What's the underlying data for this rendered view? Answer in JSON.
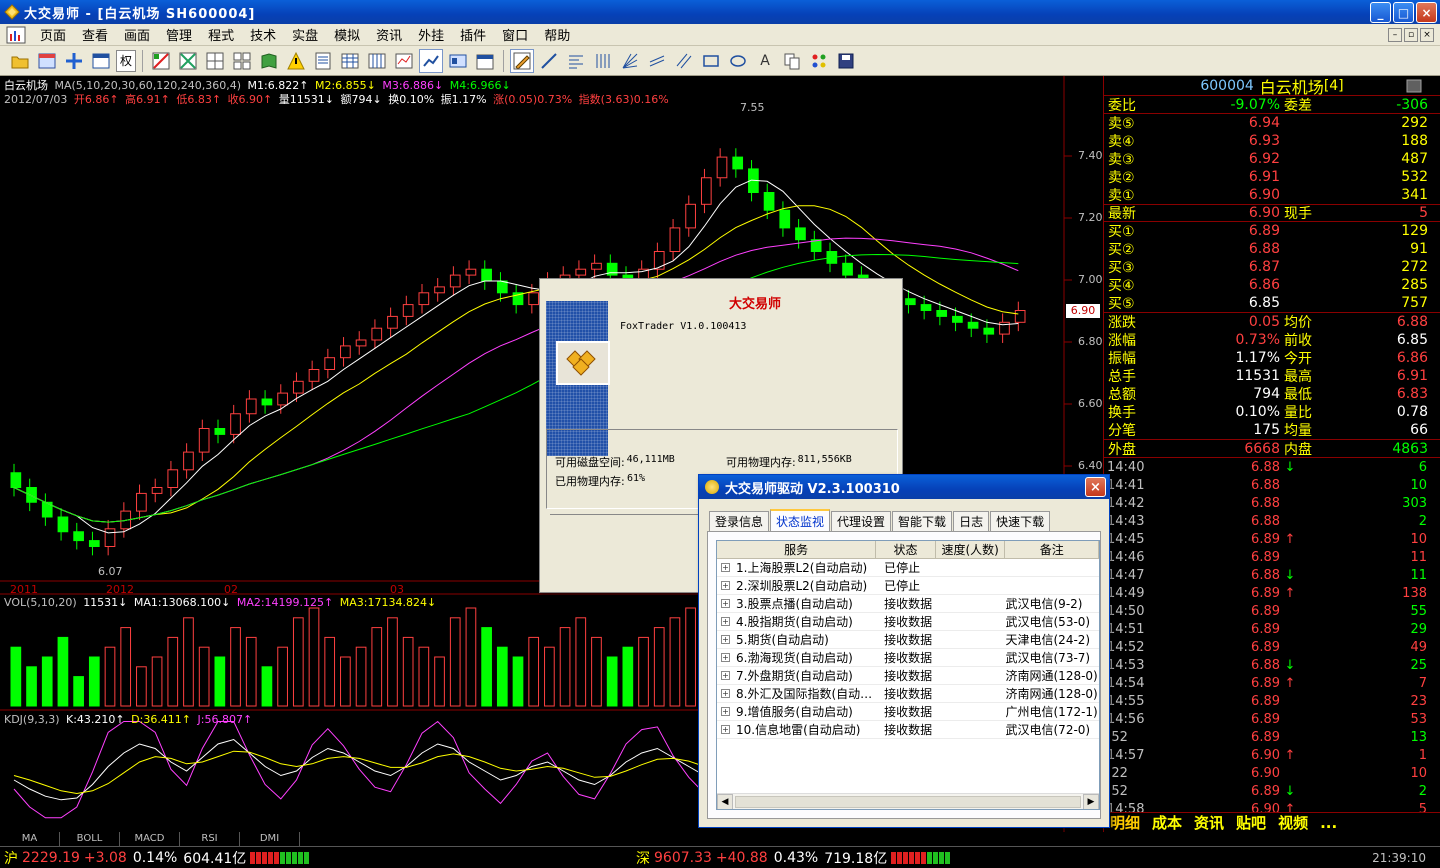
{
  "window": {
    "title": "大交易师 - [白云机场 SH600004]",
    "min": "_",
    "max": "□",
    "close": "×"
  },
  "menu": [
    "页面",
    "查看",
    "画面",
    "管理",
    "程式",
    "技术",
    "实盘",
    "模拟",
    "资讯",
    "外挂",
    "插件",
    "窗口",
    "帮助"
  ],
  "toolbar": {
    "rights_label": "权",
    "text_tool": "A"
  },
  "chart": {
    "stock_label": "白云机场",
    "ma_header": "MA(5,10,20,30,60,120,240,360,4)",
    "m1": "M1:6.822↑",
    "m2": "M2:6.855↓",
    "m3": "M3:6.886↓",
    "m4": "M4:6.966↓",
    "date": "2012/07/03",
    "open": "开6.86↑",
    "high": "高6.91↑",
    "low": "低6.83↑",
    "close": "收6.90↑",
    "vol": "量11531↓",
    "amount": "额794↓",
    "turnover": "换0.10%",
    "amplitude": "振1.17%",
    "change": "涨(0.05)0.73%",
    "index": "指数(3.63)0.16%",
    "price_ticks": [
      "7.40",
      "7.20",
      "7.00",
      "6.80",
      "6.60",
      "6.40"
    ],
    "current_price": "6.90",
    "hi_mark": "7.55",
    "lo_mark": "6.07",
    "time_labels": [
      "2011",
      "2012",
      "02",
      "03"
    ],
    "vol_header": "VOL(5,10,20)",
    "vol_value": "11531↓",
    "vol_ma1": "MA1:13068.100↓",
    "vol_ma2": "MA2:14199.125↑",
    "vol_ma3": "MA3:17134.824↓",
    "kdj_header": "KDJ(9,3,3)",
    "kdj_k": "K:43.210↑",
    "kdj_d": "D:36.411↑",
    "kdj_j": "J:56.807↑",
    "candles": {
      "opens": [
        6.35,
        6.3,
        6.25,
        6.2,
        6.15,
        6.12,
        6.1,
        6.16,
        6.22,
        6.28,
        6.3,
        6.36,
        6.42,
        6.5,
        6.48,
        6.55,
        6.6,
        6.58,
        6.62,
        6.66,
        6.7,
        6.74,
        6.78,
        6.8,
        6.84,
        6.88,
        6.92,
        6.96,
        6.98,
        7.02,
        7.04,
        7.0,
        6.96,
        6.92,
        6.96,
        7.0,
        7.02,
        7.04,
        7.06,
        7.02,
        7.0,
        7.04,
        7.1,
        7.18,
        7.26,
        7.35,
        7.42,
        7.38,
        7.3,
        7.24,
        7.18,
        7.14,
        7.1,
        7.06,
        7.02,
        6.98,
        6.96,
        6.94,
        6.92,
        6.9,
        6.88,
        6.86,
        6.84,
        6.82,
        6.86
      ],
      "closes": [
        6.3,
        6.25,
        6.2,
        6.15,
        6.12,
        6.1,
        6.16,
        6.22,
        6.28,
        6.3,
        6.36,
        6.42,
        6.5,
        6.48,
        6.55,
        6.6,
        6.58,
        6.62,
        6.66,
        6.7,
        6.74,
        6.78,
        6.8,
        6.84,
        6.88,
        6.92,
        6.96,
        6.98,
        7.02,
        7.04,
        7.0,
        6.96,
        6.92,
        6.96,
        7.0,
        7.02,
        7.04,
        7.06,
        7.02,
        7.0,
        7.04,
        7.1,
        7.18,
        7.26,
        7.35,
        7.42,
        7.38,
        7.3,
        7.24,
        7.18,
        7.14,
        7.1,
        7.06,
        7.02,
        6.98,
        6.96,
        6.94,
        6.92,
        6.9,
        6.88,
        6.86,
        6.84,
        6.82,
        6.86,
        6.9
      ]
    },
    "volumes": [
      0.6,
      0.4,
      0.5,
      0.7,
      0.3,
      0.5,
      0.6,
      0.8,
      0.4,
      0.5,
      0.7,
      0.9,
      0.6,
      0.5,
      0.8,
      0.7,
      0.4,
      0.6,
      0.9,
      1.0,
      0.7,
      0.5,
      0.6,
      0.8,
      0.9,
      0.7,
      0.6,
      0.5,
      0.9,
      1.0,
      0.8,
      0.6,
      0.5,
      0.7,
      0.6,
      0.8,
      0.9,
      0.7,
      0.5,
      0.6,
      0.7,
      0.8,
      0.9,
      1.0,
      0.95,
      0.9,
      0.7,
      0.6,
      0.5,
      0.6,
      0.7,
      0.5,
      0.6,
      0.7,
      0.6,
      0.5,
      0.4,
      0.5,
      0.6,
      0.7,
      0.5,
      0.4,
      0.5,
      0.6,
      0.5
    ],
    "kdj_k_vals": [
      40,
      30,
      22,
      18,
      20,
      35,
      55,
      70,
      80,
      75,
      60,
      50,
      65,
      80,
      85,
      70,
      55,
      45,
      50,
      65,
      75,
      70,
      60,
      50,
      45,
      55,
      70,
      80,
      75,
      60,
      50,
      40,
      45,
      55,
      60,
      50,
      40,
      35,
      45,
      60,
      70,
      75,
      65,
      55,
      45,
      40,
      50,
      60,
      55,
      45,
      38,
      32,
      40,
      50,
      55,
      48,
      40,
      36,
      42,
      50,
      46,
      40,
      38,
      42,
      43
    ],
    "kdj_d_vals": [
      45,
      40,
      34,
      28,
      25,
      28,
      36,
      48,
      60,
      66,
      64,
      58,
      60,
      66,
      72,
      71,
      65,
      58,
      55,
      58,
      64,
      66,
      64,
      59,
      54,
      54,
      59,
      66,
      69,
      66,
      60,
      53,
      50,
      52,
      55,
      53,
      48,
      43,
      44,
      50,
      57,
      63,
      64,
      61,
      55,
      50,
      50,
      53,
      54,
      51,
      46,
      41,
      41,
      44,
      48,
      48,
      45,
      42,
      42,
      45,
      45,
      43,
      41,
      41,
      36
    ]
  },
  "about": {
    "title": "大交易师",
    "version": "FoxTrader V1.0.100413",
    "disk_label": "可用磁盘空间:",
    "disk_value": "46,111MB",
    "phys_label": "可用物理内存:",
    "phys_value": "811,556KB",
    "used_label": "已用物理内存:",
    "used_value": "61%"
  },
  "driver": {
    "title": "大交易师驱动 V2.3.100310",
    "close": "×",
    "tabs": [
      "登录信息",
      "状态监视",
      "代理设置",
      "智能下载",
      "日志",
      "快速下载"
    ],
    "active_tab": 1,
    "columns": [
      "服务",
      "状态",
      "速度(人数)",
      "备注"
    ],
    "rows": [
      {
        "service": "1.上海股票L2(自动启动)",
        "status": "已停止",
        "speed": "",
        "note": ""
      },
      {
        "service": "2.深圳股票L2(自动启动)",
        "status": "已停止",
        "speed": "",
        "note": ""
      },
      {
        "service": "3.股票点播(自动启动)",
        "status": "接收数据",
        "speed": "",
        "note": "武汉电信(9-2)"
      },
      {
        "service": "4.股指期货(自动启动)",
        "status": "接收数据",
        "speed": "",
        "note": "武汉电信(53-0)"
      },
      {
        "service": "5.期货(自动启动)",
        "status": "接收数据",
        "speed": "",
        "note": "天津电信(24-2)"
      },
      {
        "service": "6.渤海现货(自动启动)",
        "status": "接收数据",
        "speed": "",
        "note": "武汉电信(73-7)"
      },
      {
        "service": "7.外盘期货(自动启动)",
        "status": "接收数据",
        "speed": "",
        "note": "济南网通(128-0)"
      },
      {
        "service": "8.外汇及国际指数(自动…",
        "status": "接收数据",
        "speed": "",
        "note": "济南网通(128-0)"
      },
      {
        "service": "9.增值服务(自动启动)",
        "status": "接收数据",
        "speed": "",
        "note": "广州电信(172-1)"
      },
      {
        "service": "10.信息地雷(自动启动)",
        "status": "接收数据",
        "speed": "",
        "note": "武汉电信(72-0)"
      }
    ]
  },
  "quote": {
    "code": "600004",
    "name": "白云机场",
    "mark": "[4]",
    "weibi_label": "委比",
    "weibi": "-9.07%",
    "weicha_label": "委差",
    "weicha": "-306",
    "asks": [
      {
        "label": "卖⑤",
        "price": "6.94",
        "vol": "292"
      },
      {
        "label": "卖④",
        "price": "6.93",
        "vol": "188"
      },
      {
        "label": "卖③",
        "price": "6.92",
        "vol": "487"
      },
      {
        "label": "卖②",
        "price": "6.91",
        "vol": "532"
      },
      {
        "label": "卖①",
        "price": "6.90",
        "vol": "341"
      }
    ],
    "last_label": "最新",
    "last": "6.90",
    "xianshou_label": "现手",
    "xianshou": "5",
    "bids": [
      {
        "label": "买①",
        "price": "6.89",
        "vol": "129"
      },
      {
        "label": "买②",
        "price": "6.88",
        "vol": "91"
      },
      {
        "label": "买③",
        "price": "6.87",
        "vol": "272"
      },
      {
        "label": "买④",
        "price": "6.86",
        "vol": "285"
      },
      {
        "label": "买⑤",
        "price": "6.85",
        "vol": "757"
      }
    ],
    "stats": [
      {
        "l1": "涨跌",
        "v1": "0.05",
        "c1": "red",
        "l2": "均价",
        "v2": "6.88",
        "c2": "red"
      },
      {
        "l1": "涨幅",
        "v1": "0.73%",
        "c1": "red",
        "l2": "前收",
        "v2": "6.85",
        "c2": "white"
      },
      {
        "l1": "振幅",
        "v1": "1.17%",
        "c1": "white",
        "l2": "今开",
        "v2": "6.86",
        "c2": "red"
      },
      {
        "l1": "总手",
        "v1": "11531",
        "c1": "white",
        "l2": "最高",
        "v2": "6.91",
        "c2": "red"
      },
      {
        "l1": "总额",
        "v1": "794",
        "c1": "white",
        "l2": "最低",
        "v2": "6.83",
        "c2": "red"
      },
      {
        "l1": "换手",
        "v1": "0.10%",
        "c1": "white",
        "l2": "量比",
        "v2": "0.78",
        "c2": "white"
      },
      {
        "l1": "分笔",
        "v1": "175",
        "c1": "white",
        "l2": "均量",
        "v2": "66",
        "c2": "white"
      }
    ],
    "outer_label": "外盘",
    "outer": "6668",
    "inner_label": "内盘",
    "inner": "4863",
    "ticks": [
      {
        "t": "14:40",
        "p": "6.88",
        "a": "↓",
        "ac": "green",
        "v": "6",
        "vc": "green"
      },
      {
        "t": "14:41",
        "p": "6.88",
        "a": "",
        "ac": "",
        "v": "10",
        "vc": "green"
      },
      {
        "t": "14:42",
        "p": "6.88",
        "a": "",
        "ac": "",
        "v": "303",
        "vc": "green"
      },
      {
        "t": "14:43",
        "p": "6.88",
        "a": "",
        "ac": "",
        "v": "2",
        "vc": "green"
      },
      {
        "t": "14:45",
        "p": "6.89",
        "a": "↑",
        "ac": "red",
        "v": "10",
        "vc": "red"
      },
      {
        "t": "14:46",
        "p": "6.89",
        "a": "",
        "ac": "",
        "v": "11",
        "vc": "red"
      },
      {
        "t": "14:47",
        "p": "6.88",
        "a": "↓",
        "ac": "green",
        "v": "11",
        "vc": "green"
      },
      {
        "t": "14:49",
        "p": "6.89",
        "a": "↑",
        "ac": "red",
        "v": "138",
        "vc": "red"
      },
      {
        "t": "14:50",
        "p": "6.89",
        "a": "",
        "ac": "",
        "v": "55",
        "vc": "green"
      },
      {
        "t": "14:51",
        "p": "6.89",
        "a": "",
        "ac": "",
        "v": "29",
        "vc": "green"
      },
      {
        "t": "14:52",
        "p": "6.89",
        "a": "",
        "ac": "",
        "v": "49",
        "vc": "red"
      },
      {
        "t": "14:53",
        "p": "6.88",
        "a": "↓",
        "ac": "green",
        "v": "25",
        "vc": "green"
      },
      {
        "t": "14:54",
        "p": "6.89",
        "a": "↑",
        "ac": "red",
        "v": "7",
        "vc": "red"
      },
      {
        "t": "14:55",
        "p": "6.89",
        "a": "",
        "ac": "",
        "v": "23",
        "vc": "red"
      },
      {
        "t": "14:56",
        "p": "6.89",
        "a": "",
        "ac": "",
        "v": "53",
        "vc": "red"
      },
      {
        "t": ":52",
        "p": "6.89",
        "a": "",
        "ac": "",
        "v": "13",
        "vc": "green"
      },
      {
        "t": "14:57",
        "p": "6.90",
        "a": "↑",
        "ac": "red",
        "v": "1",
        "vc": "red"
      },
      {
        "t": ":22",
        "p": "6.90",
        "a": "",
        "ac": "",
        "v": "10",
        "vc": "red"
      },
      {
        "t": ":52",
        "p": "6.89",
        "a": "↓",
        "ac": "green",
        "v": "2",
        "vc": "green"
      },
      {
        "t": "14:58",
        "p": "6.90",
        "a": "↑",
        "ac": "red",
        "v": "5",
        "vc": "red"
      }
    ],
    "tabs": [
      "明细",
      "成本",
      "资讯",
      "贴吧",
      "视频",
      "..."
    ]
  },
  "indicator_tabs": [
    "MA",
    "BOLL",
    "MACD",
    "RSI",
    "DMI"
  ],
  "status": {
    "sh_label": "沪",
    "sh_index": "2229.19",
    "sh_change": "+3.08",
    "sh_pct": "0.14%",
    "sh_amount": "604.41亿",
    "sz_label": "深",
    "sz_index": "9607.33",
    "sz_change": "+40.88",
    "sz_pct": "0.43%",
    "sz_amount": "719.18亿",
    "clock": "21:39:10"
  },
  "colors": {
    "up": "#ff4040",
    "down": "#00ff00",
    "accent_yellow": "#ffff00",
    "grid_red": "#8a0000"
  }
}
